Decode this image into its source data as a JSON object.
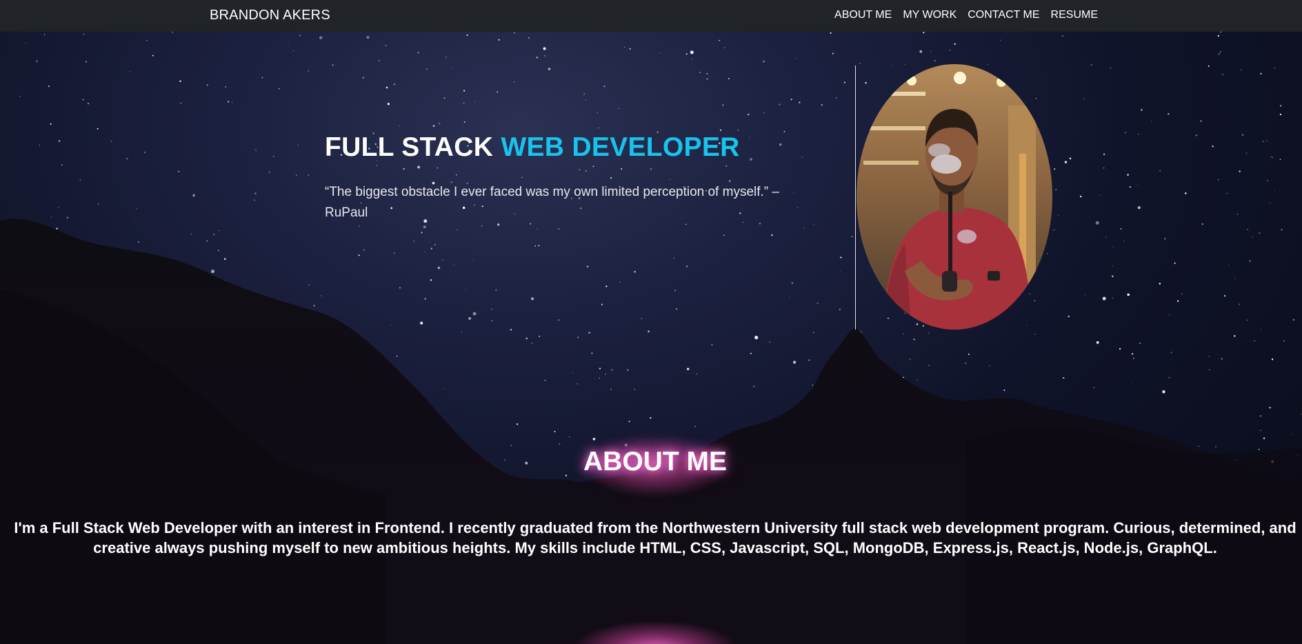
{
  "navbar": {
    "brand": "BRANDON AKERS",
    "links": [
      "ABOUT ME",
      "MY WORK",
      "CONTACT ME",
      "RESUME"
    ]
  },
  "hero": {
    "title_plain": "FULL STACK ",
    "title_accent": "WEB DEVELOPER",
    "quote": "“The biggest obstacle I ever faced was my own limited perception of myself.” – RuPaul"
  },
  "about": {
    "heading": "ABOUT ME",
    "body": "I'm a Full Stack Web Developer with an interest in Frontend. I recently graduated from the Northwestern University full stack web development program. Curious, determined, and creative always pushing myself to new ambitious heights. My skills include HTML, CSS, Javascript, SQL, MongoDB, Express.js, React.js, Node.js, GraphQL."
  },
  "colors": {
    "navbar_bg": "#202327",
    "accent": "#18c3ee",
    "glow": "#ff6ccf"
  }
}
